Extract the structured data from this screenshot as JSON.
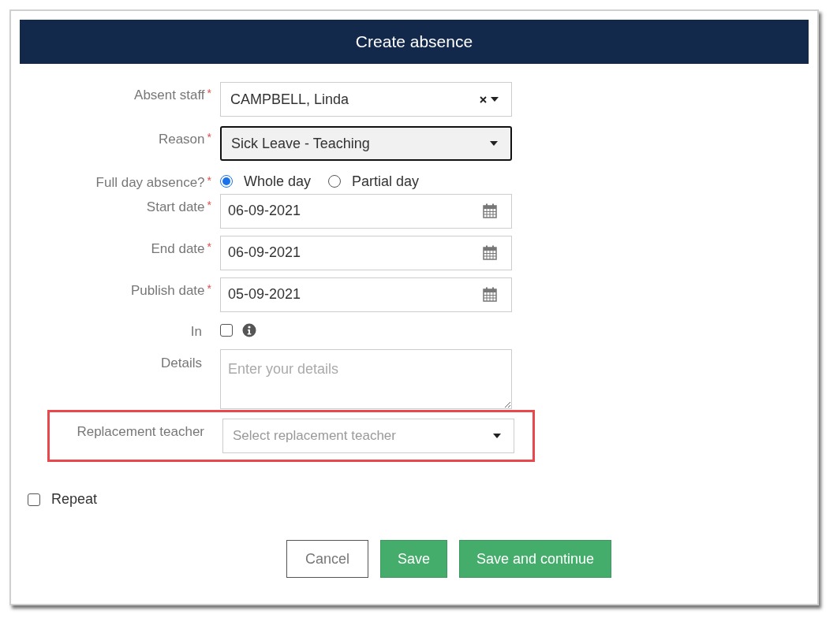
{
  "dialog": {
    "title": "Create absence"
  },
  "fields": [
    {
      "kind": "select",
      "label": "Absent staff",
      "required_mark": "*",
      "value": "CAMPBELL, Linda",
      "clearable": true,
      "focused": false
    },
    {
      "kind": "select",
      "label": "Reason",
      "required_mark": "*",
      "value": "Sick Leave - Teaching",
      "clearable": false,
      "focused": true
    },
    {
      "kind": "radio",
      "label": "Full day absence?",
      "required_mark": "*",
      "options": [
        {
          "label": "Whole day",
          "selected": true
        },
        {
          "label": "Partial day",
          "selected": false
        }
      ]
    },
    {
      "kind": "date",
      "label": "Start date",
      "required_mark": "*",
      "value": "06-09-2021"
    },
    {
      "kind": "date",
      "label": "End date",
      "required_mark": "*",
      "value": "06-09-2021"
    },
    {
      "kind": "date",
      "label": "Publish date",
      "required_mark": "*",
      "value": "05-09-2021"
    },
    {
      "kind": "checkbox",
      "label": "In",
      "checked": false
    },
    {
      "kind": "textarea",
      "label": "Details",
      "placeholder": "Enter your details"
    },
    {
      "kind": "select",
      "label": "Replacement teacher",
      "placeholder": "Select replacement teacher",
      "clearable": false,
      "focused": false,
      "highlighted": true
    }
  ],
  "repeat": {
    "label": "Repeat",
    "checked": false
  },
  "buttons": [
    {
      "label": "Cancel",
      "kind": "secondary"
    },
    {
      "label": "Save",
      "kind": "primary"
    },
    {
      "label": "Save and continue",
      "kind": "primary"
    }
  ]
}
